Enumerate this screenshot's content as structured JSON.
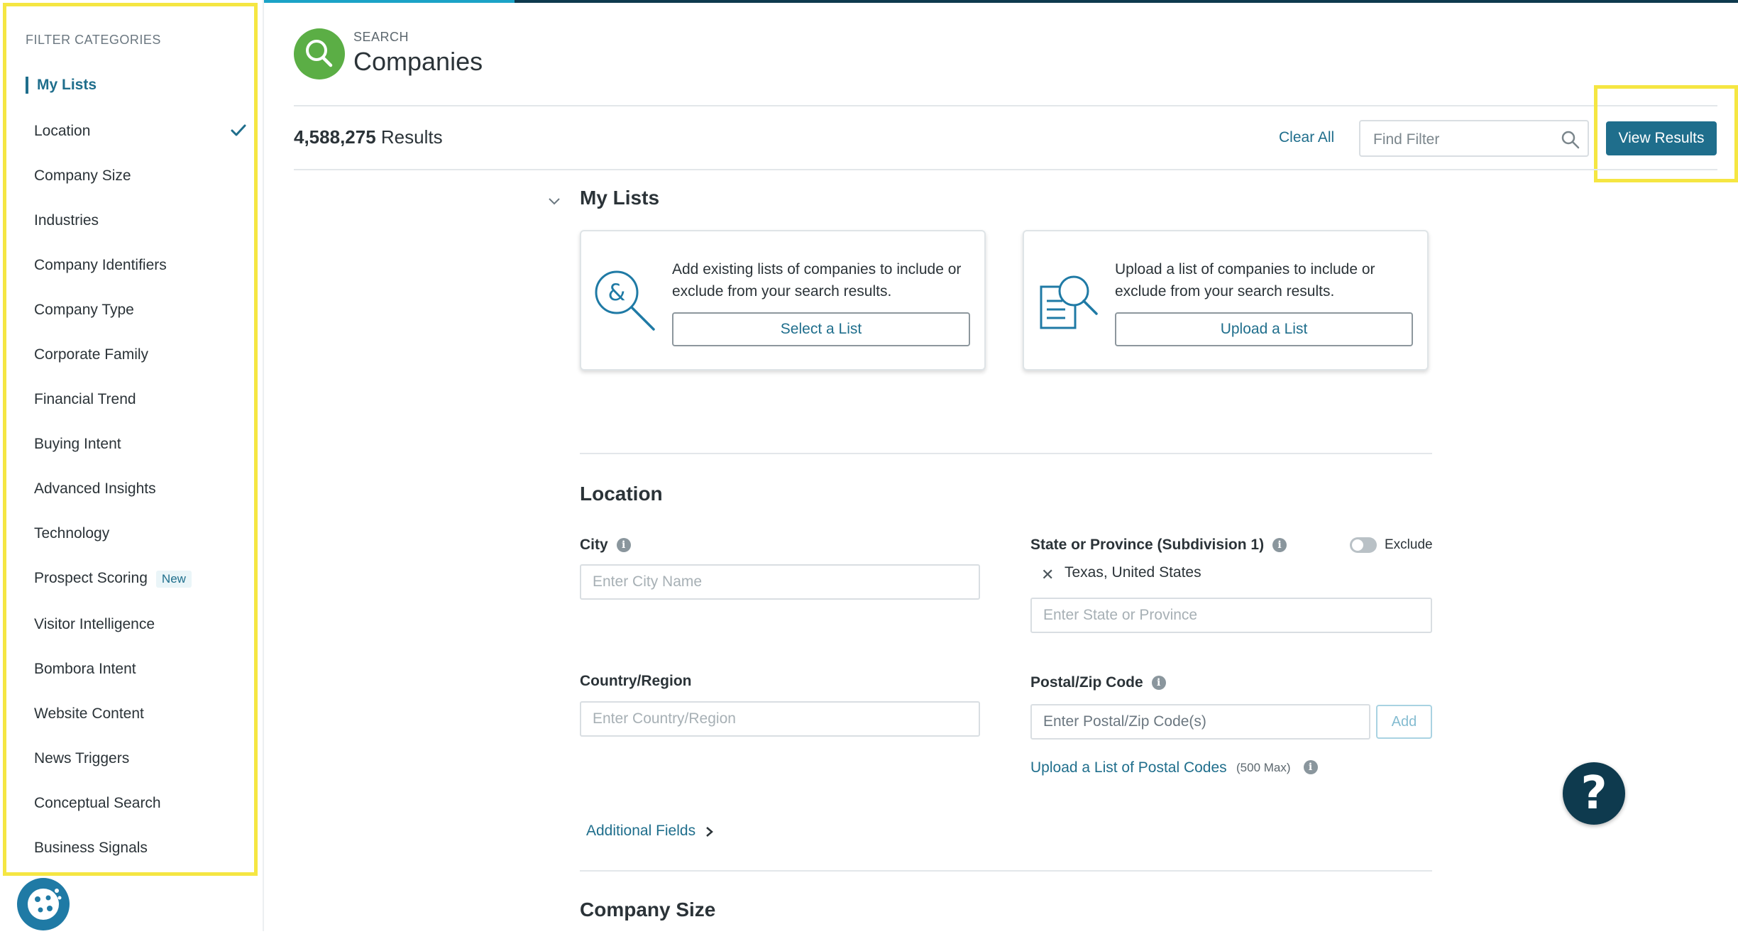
{
  "sidebar": {
    "title": "FILTER CATEGORIES",
    "items": [
      {
        "label": "My Lists"
      },
      {
        "label": "Location"
      },
      {
        "label": "Company Size"
      },
      {
        "label": "Industries"
      },
      {
        "label": "Company Identifiers"
      },
      {
        "label": "Company Type"
      },
      {
        "label": "Corporate Family"
      },
      {
        "label": "Financial Trend"
      },
      {
        "label": "Buying Intent"
      },
      {
        "label": "Advanced Insights"
      },
      {
        "label": "Technology"
      },
      {
        "label": "Prospect Scoring",
        "badge": "New"
      },
      {
        "label": "Visitor Intelligence"
      },
      {
        "label": "Bombora Intent"
      },
      {
        "label": "Website Content"
      },
      {
        "label": "News Triggers"
      },
      {
        "label": "Conceptual Search"
      },
      {
        "label": "Business Signals"
      }
    ],
    "active_item": "My Lists",
    "checked_item": "Location",
    "cookie_icon": "cookie-icon"
  },
  "header": {
    "search_label": "SEARCH",
    "title": "Companies",
    "icon": "search-icon"
  },
  "toolbar": {
    "results_count": "4,588,275",
    "results_label": "Results",
    "clear_all": "Clear All",
    "find_filter_placeholder": "Find Filter",
    "view_results": "View Results"
  },
  "my_lists": {
    "title": "My Lists",
    "cards": [
      {
        "text": "Add existing lists of companies to include or exclude from your search results.",
        "button": "Select a List",
        "icon": "list-search-icon"
      },
      {
        "text": "Upload a list of companies to include or exclude from your search results.",
        "button": "Upload a List",
        "icon": "document-search-icon"
      }
    ]
  },
  "location": {
    "title": "Location",
    "city": {
      "label": "City",
      "placeholder": "Enter City Name"
    },
    "state": {
      "label": "State or Province (Subdivision 1)",
      "placeholder": "Enter State or Province",
      "selected": "Texas, United States",
      "exclude_label": "Exclude"
    },
    "country": {
      "label": "Country/Region",
      "placeholder": "Enter Country/Region"
    },
    "postal": {
      "label": "Postal/Zip Code",
      "placeholder": "Enter Postal/Zip Code(s)",
      "add_button": "Add",
      "upload_link": "Upload a List of Postal Codes",
      "max_note": "(500 Max)"
    },
    "additional_fields": "Additional Fields"
  },
  "company_size": {
    "title": "Company Size"
  },
  "help_label": "?",
  "colors": {
    "accent": "#1f6e8c",
    "brand_green": "#5bae45",
    "highlight": "#f5e642",
    "dark_navy": "#0e3a4e"
  }
}
